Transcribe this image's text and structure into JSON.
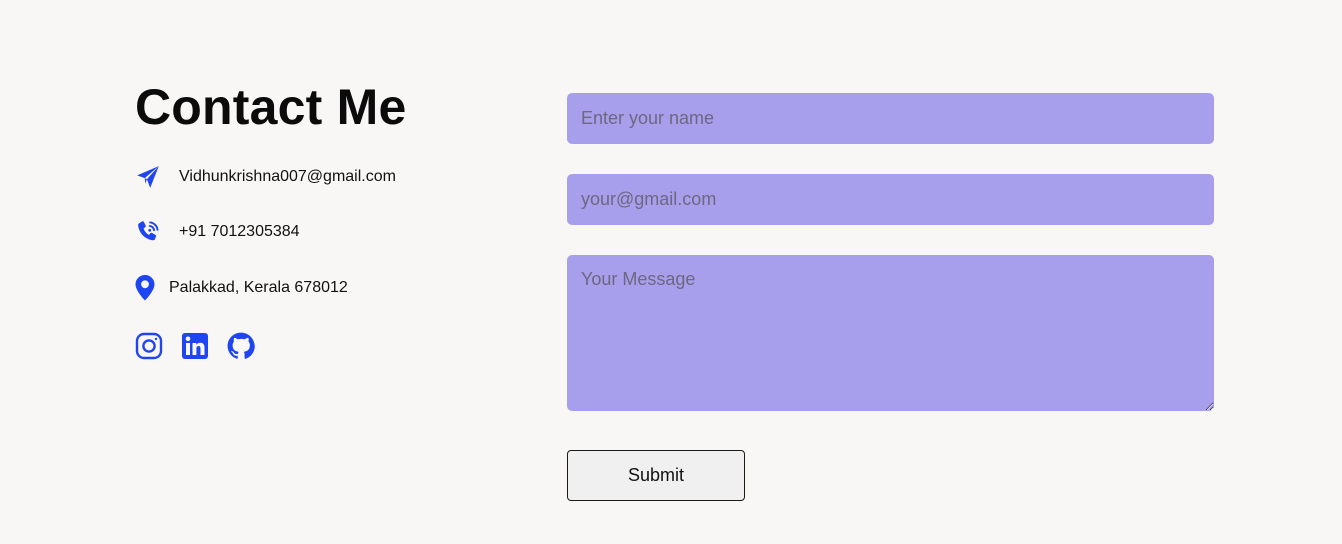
{
  "contact": {
    "title": "Contact Me",
    "email": "Vidhunkrishna007@gmail.com",
    "phone": "+91 7012305384",
    "location": "Palakkad, Kerala 678012",
    "email_icon": "paper-plane-icon",
    "phone_icon": "phone-volume-icon",
    "location_icon": "map-pin-icon",
    "socials": [
      {
        "name": "instagram-icon"
      },
      {
        "name": "linkedin-icon"
      },
      {
        "name": "github-icon"
      }
    ]
  },
  "form": {
    "name_placeholder": "Enter your name",
    "name_value": "",
    "email_placeholder": "your@gmail.com",
    "email_value": "",
    "message_placeholder": "Your Message",
    "message_value": "",
    "submit_label": "Submit"
  },
  "colors": {
    "accent": "#1f45f2",
    "field_background": "#a79fec",
    "page_background": "#f8f7f6"
  }
}
